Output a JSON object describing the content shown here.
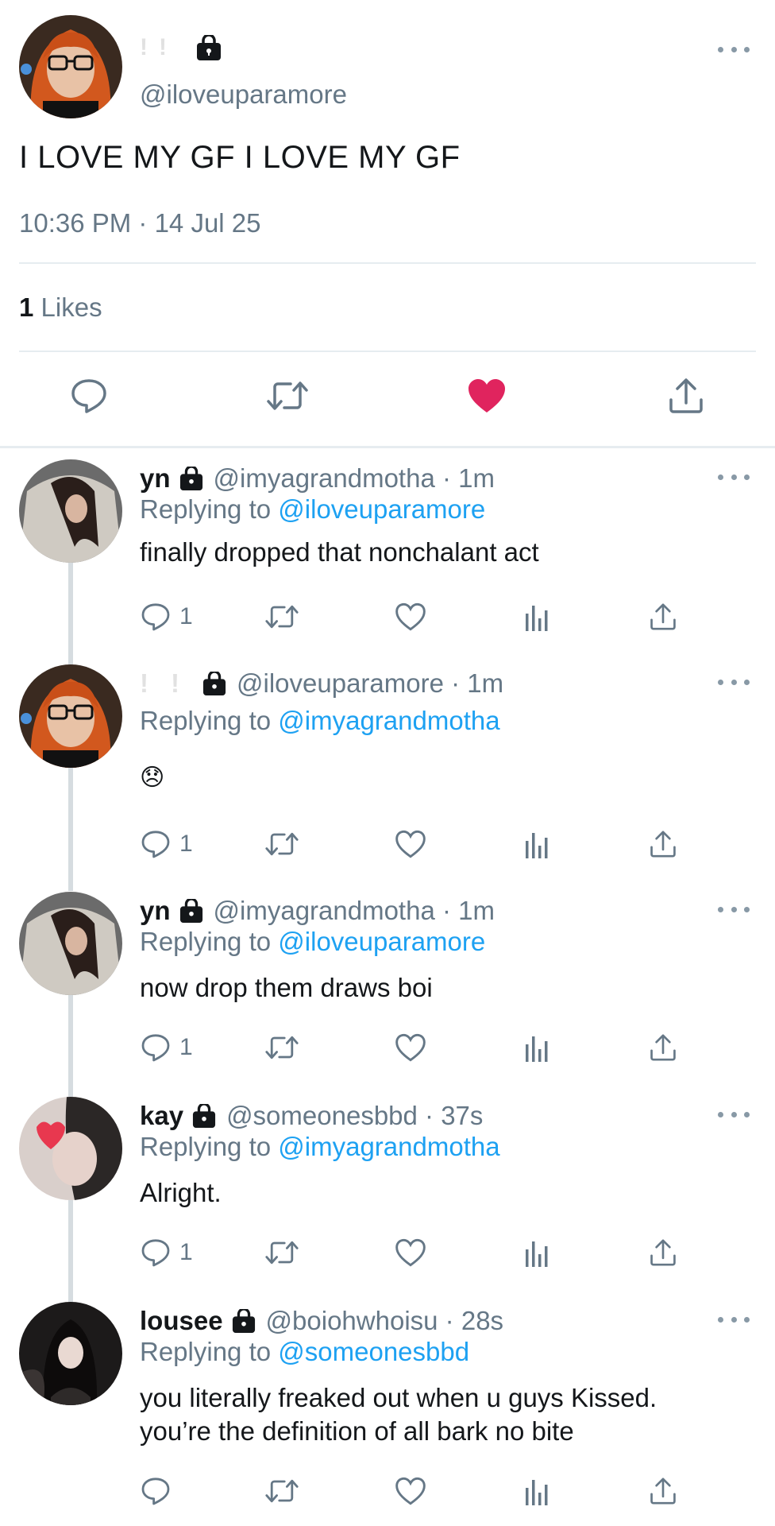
{
  "main_tweet": {
    "display_name_glyphs": [
      "!",
      "!"
    ],
    "handle": "@iloveuparamore",
    "text": "I LOVE MY GF I LOVE MY GF",
    "timestamp": "10:36 PM · 14 Jul 25",
    "likes_count": "1",
    "likes_label": "Likes",
    "liked": true,
    "icons": [
      "reply-icon",
      "retweet-icon",
      "heart-filled-icon",
      "share-icon"
    ]
  },
  "replies": [
    {
      "name": "yn",
      "handle": "@imyagrandmotha · 1m",
      "replying_prefix": "Replying to",
      "replying_to": "@iloveuparamore",
      "text": "finally dropped that nonchalant act",
      "reply_count": "1"
    },
    {
      "name_glyphs": [
        "!",
        "!"
      ],
      "handle": "@iloveuparamore · 1m",
      "replying_prefix": "Replying to",
      "replying_to": "@imyagrandmotha",
      "text": "😞",
      "reply_count": "1"
    },
    {
      "name": "yn",
      "handle": "@imyagrandmotha · 1m",
      "replying_prefix": "Replying to",
      "replying_to": "@iloveuparamore",
      "text": "now drop them draws boi",
      "reply_count": "1"
    },
    {
      "name": "kay",
      "handle": "@someonesbbd · 37s",
      "replying_prefix": "Replying to",
      "replying_to": "@imyagrandmotha",
      "text": "Alright.",
      "reply_count": "1"
    },
    {
      "name": "lousee",
      "handle": "@boiohwhoisu · 28s",
      "replying_prefix": "Replying to",
      "replying_to": "@someonesbbd",
      "text_line1": "you literally freaked out when u guys Kissed.",
      "text_line2": "you’re the definition of all bark no bite",
      "reply_count": ""
    }
  ],
  "colors": {
    "accent": "#1da1f2",
    "like": "#e0245e",
    "muted": "#657786",
    "text": "#14171a"
  }
}
